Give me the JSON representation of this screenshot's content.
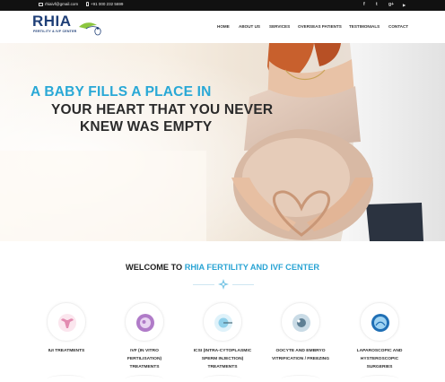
{
  "topbar": {
    "email": "rhiaivf@gmail.com",
    "phone": "+91 000 232 5699",
    "social_icons": [
      "facebook-icon",
      "twitter-icon",
      "google-plus-icon",
      "youtube-icon"
    ],
    "social_glyphs": [
      "f",
      "t",
      "g+",
      "▶"
    ]
  },
  "header": {
    "logo_text": "RHIA",
    "logo_sub": "FERTILITY & IVF CENTER",
    "nav": [
      "HOME",
      "ABOUT US",
      "SERVICES",
      "OVERSEAS PATIENTS",
      "TESTIMONIALS",
      "CONTACT"
    ]
  },
  "hero": {
    "line1": "A BABY FILLS A PLACE IN",
    "line2": "YOUR HEART THAT YOU NEVER",
    "line3": "KNEW WAS EMPTY"
  },
  "welcome": {
    "prefix": "WELCOME TO ",
    "highlight": "RHIA FERTILITY AND IVF CENTER"
  },
  "services": [
    {
      "line1": "IUI TREATMENTS",
      "line2": "",
      "line3": "",
      "icon": "uterus-icon"
    },
    {
      "line1": "IVF (IN VITRO",
      "line2": "FERTILISATION)",
      "line3": "TREATMENTS",
      "icon": "embryo-icon"
    },
    {
      "line1": "ICSI (INTRA-CYTOPLASMIC",
      "line2": "SPERM INJECTION)",
      "line3": "TREATMENTS",
      "icon": "injection-icon"
    },
    {
      "line1": "OOCYTE AND EMBRYO",
      "line2": "VITRIFICATION / FREEZING",
      "line3": "",
      "icon": "oocyte-icon"
    },
    {
      "line1": "LAPAROSCOPIC AND",
      "line2": "HYSTEROSCOPIC",
      "line3": "SURGERIES",
      "icon": "laparoscopy-icon"
    }
  ],
  "colors": {
    "accent": "#29a8d6",
    "brand": "#1f3f77",
    "topbar": "#111111"
  }
}
